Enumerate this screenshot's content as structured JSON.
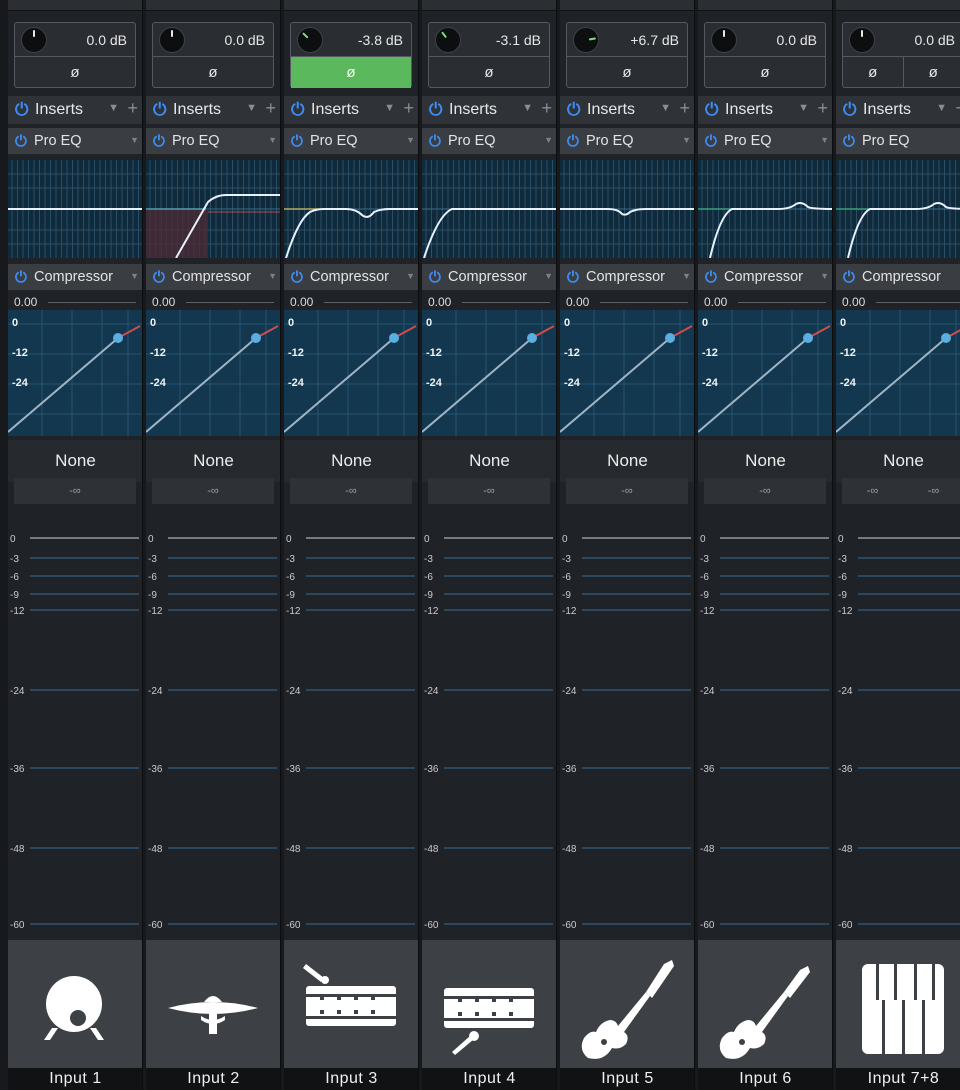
{
  "inserts_label": "Inserts",
  "plugins": [
    "Pro EQ",
    "Compressor"
  ],
  "compressor_threshold": "0.00",
  "comp_scale": [
    "0",
    "-12",
    "-24"
  ],
  "meter_scale": [
    "0",
    "-3",
    "-6",
    "-9",
    "-12",
    "-24",
    "-36",
    "-48",
    "-60"
  ],
  "colors": {
    "power": "#3d8df5",
    "phase_on": "#5cb85c",
    "eq_curve": "#e8f2ff",
    "meter_line": "#3a6d96"
  },
  "channels": [
    {
      "name": "Input  1",
      "trim": "0.0 dB",
      "knob_level": 0.0,
      "phase": [
        "ø"
      ],
      "phase_on": false,
      "send": "None",
      "peak": [
        "-∞"
      ],
      "icon": "kick-drum-icon",
      "eq_shape": "flat"
    },
    {
      "name": "Input  2",
      "trim": "0.0 dB",
      "knob_level": 0.0,
      "phase": [
        "ø"
      ],
      "phase_on": false,
      "send": "None",
      "peak": [
        "-∞"
      ],
      "icon": "cymbal-icon",
      "eq_shape": "highpass-high"
    },
    {
      "name": "Input  3",
      "trim": "-3.8 dB",
      "knob_level": -3.8,
      "phase": [
        "ø"
      ],
      "phase_on": true,
      "send": "None",
      "peak": [
        "-∞"
      ],
      "icon": "snare-top-icon",
      "eq_shape": "highpass-dip"
    },
    {
      "name": "Input  4",
      "trim": "-3.1 dB",
      "knob_level": -3.1,
      "phase": [
        "ø"
      ],
      "phase_on": false,
      "send": "None",
      "peak": [
        "-∞"
      ],
      "icon": "snare-bottom-icon",
      "eq_shape": "highpass-low"
    },
    {
      "name": "Input  5",
      "trim": "+6.7 dB",
      "knob_level": 6.7,
      "phase": [
        "ø"
      ],
      "phase_on": false,
      "send": "None",
      "peak": [
        "-∞"
      ],
      "icon": "bass-guitar-icon",
      "eq_shape": "dip-only"
    },
    {
      "name": "Input  6",
      "trim": "0.0 dB",
      "knob_level": 0.0,
      "phase": [
        "ø"
      ],
      "phase_on": false,
      "send": "None",
      "peak": [
        "-∞"
      ],
      "icon": "electric-guitar-icon",
      "eq_shape": "highpass-bump"
    },
    {
      "name": "Input  7+8",
      "trim": "0.0 dB",
      "knob_level": 0.0,
      "phase": [
        "ø",
        "ø"
      ],
      "phase_on": false,
      "send": "None",
      "peak": [
        "-∞",
        "-∞"
      ],
      "icon": "keyboard-icon",
      "eq_shape": "highpass-bump"
    }
  ]
}
